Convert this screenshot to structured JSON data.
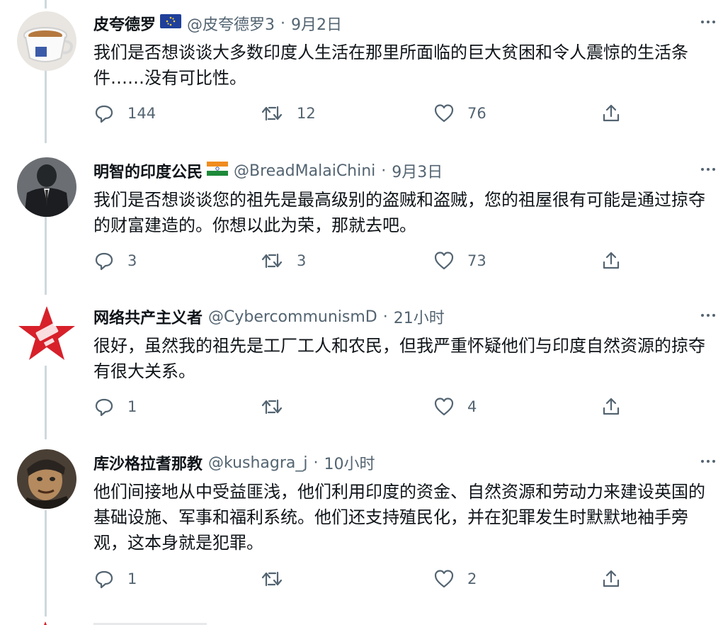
{
  "tweets": [
    {
      "display_name": "皮夸德罗",
      "flag": "eu-flag",
      "handle": "@皮夸德罗3",
      "date": "9月2日",
      "text": "我们是否想谈谈大多数印度人生活在那里所面临的巨大贫困和令人震惊的生活条件……没有可比性。",
      "replies": "144",
      "retweets": "12",
      "likes": "76"
    },
    {
      "display_name": "明智的印度公民",
      "flag": "india-flag",
      "handle": "@BreadMalaiChini",
      "date": "9月3日",
      "text": "我们是否想谈谈您的祖先是最高级别的盗贼和盗贼，您的祖屋很有可能是通过掠夺的财富建造的。你想以此为荣，那就去吧。",
      "replies": "3",
      "retweets": "3",
      "likes": "73"
    },
    {
      "display_name": "网络共产主义者",
      "handle": "@CybercommunismD",
      "date": "21小时",
      "text": "很好，虽然我的祖先是工厂工人和农民，但我严重怀疑他们与印度自然资源的掠夺有很大关系。",
      "replies": "1",
      "retweets": "",
      "likes": "4"
    },
    {
      "display_name": "库沙格拉耆那教",
      "handle": "@kushagra_j",
      "date": "10小时",
      "text": "他们间接地从中受益匪浅，他们利用印度的资金、自然资源和劳动力来建设英国的基础设施、军事和福利系统。他们还支持殖民化，并在犯罪发生时默默地袖手旁观，这本身就是犯罪。",
      "replies": "1",
      "retweets": "",
      "likes": "2"
    }
  ],
  "separator": "·",
  "icons": {
    "reply": "reply-icon",
    "retweet": "retweet-icon",
    "like": "heart-icon",
    "share": "share-icon",
    "more": "more-icon"
  },
  "colors": {
    "text": "#0f1419",
    "secondary": "#536471",
    "connector": "#cfd9de",
    "avatar_red": "#d7202a"
  }
}
